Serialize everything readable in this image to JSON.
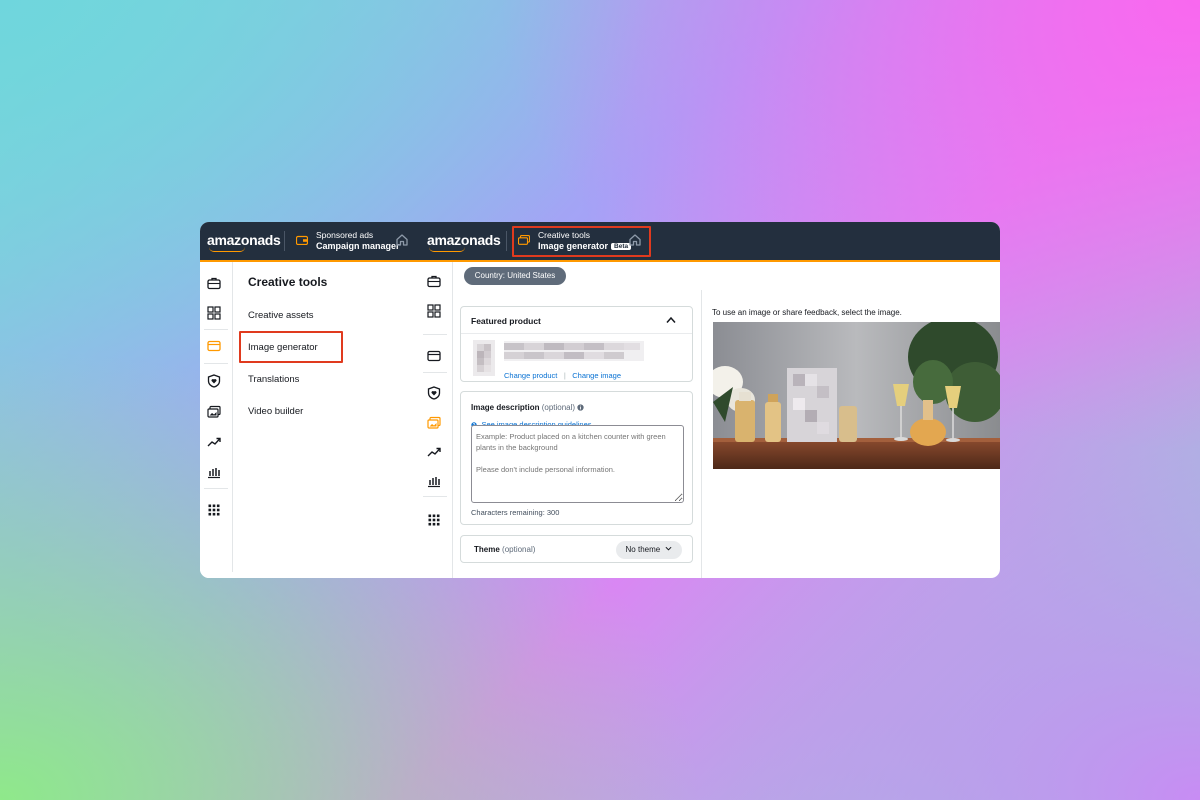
{
  "topbar": {
    "logo_left": "amazonads",
    "app1": {
      "line1": "Sponsored ads",
      "line2": "Campaign manager"
    },
    "logo_right": "amazonads",
    "app2": {
      "line1": "Creative tools",
      "line2": "Image generator",
      "badge": "Beta"
    }
  },
  "sidebar": {
    "title": "Creative tools",
    "items": [
      {
        "label": "Creative assets"
      },
      {
        "label": "Image generator",
        "selected": true
      },
      {
        "label": "Translations"
      },
      {
        "label": "Video builder"
      }
    ]
  },
  "main": {
    "country": "Country: United States",
    "featured": {
      "title": "Featured product",
      "change_product": "Change product",
      "separator": "|",
      "change_image": "Change image"
    },
    "description": {
      "label": "Image description",
      "optional": "(optional)",
      "guidelines_link": "See image description guidelines",
      "placeholder": "Example: Product placed on a kitchen counter with green plants in the background\n\nPlease don't include personal information.",
      "chars_remaining": "Characters remaining: 300"
    },
    "theme": {
      "label": "Theme",
      "optional": "(optional)",
      "value": "No theme"
    }
  },
  "preview": {
    "instruction": "To use an image or share feedback, select the image."
  },
  "colors": {
    "topbar": "#232f3e",
    "accent": "#ff9900",
    "highlight": "#e03a1e",
    "link": "#0972d3"
  }
}
